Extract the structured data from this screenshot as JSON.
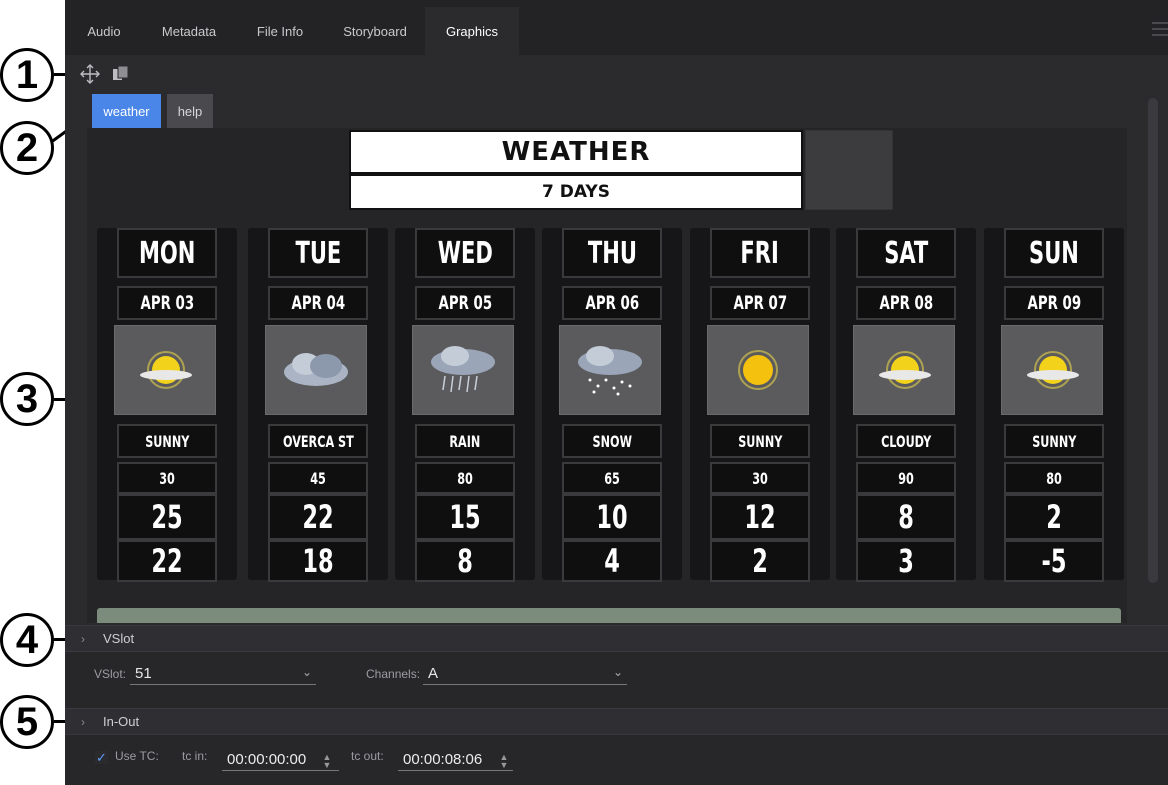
{
  "callouts": [
    "1",
    "2",
    "3",
    "4",
    "5"
  ],
  "tabs": [
    {
      "label": "Audio",
      "active": false
    },
    {
      "label": "Metadata",
      "active": false
    },
    {
      "label": "File Info",
      "active": false
    },
    {
      "label": "Storyboard",
      "active": false
    },
    {
      "label": "Graphics",
      "active": true
    }
  ],
  "toolbar": {
    "move_icon": "move-arrows-icon",
    "layers_icon": "copy-layers-icon"
  },
  "graphic_buttons": {
    "weather": "weather",
    "help": "help"
  },
  "weather": {
    "title": "WEATHER",
    "subtitle": "7 DAYS",
    "days": [
      {
        "day": "MON",
        "date": "APR 03",
        "icon": "sunny-icon",
        "condition": "SUNNY",
        "n1": "30",
        "n2": "25",
        "n3": "22"
      },
      {
        "day": "TUE",
        "date": "APR 04",
        "icon": "overcast-icon",
        "condition": "OVERCA ST",
        "n1": "45",
        "n2": "22",
        "n3": "18"
      },
      {
        "day": "WED",
        "date": "APR 05",
        "icon": "rain-icon",
        "condition": "RAIN",
        "n1": "80",
        "n2": "15",
        "n3": "8"
      },
      {
        "day": "THU",
        "date": "APR 06",
        "icon": "snow-icon",
        "condition": "SNOW",
        "n1": "65",
        "n2": "10",
        "n3": "4"
      },
      {
        "day": "FRI",
        "date": "APR 07",
        "icon": "sun-icon",
        "condition": "SUNNY",
        "n1": "30",
        "n2": "12",
        "n3": "2"
      },
      {
        "day": "SAT",
        "date": "APR 08",
        "icon": "sunny-icon",
        "condition": "CLOUDY",
        "n1": "90",
        "n2": "8",
        "n3": "3"
      },
      {
        "day": "SUN",
        "date": "APR 09",
        "icon": "sunny-icon",
        "condition": "SUNNY",
        "n1": "80",
        "n2": "2",
        "n3": "-5"
      }
    ]
  },
  "vslot": {
    "header": "VSlot",
    "vslot_label": "VSlot:",
    "vslot_value": "51",
    "channels_label": "Channels:",
    "channels_value": "A"
  },
  "inout": {
    "header": "In-Out",
    "use_tc_label": "Use TC:",
    "use_tc_checked": true,
    "tc_in_label": "tc in:",
    "tc_in_value": "00:00:00:00",
    "tc_out_label": "tc out:",
    "tc_out_value": "00:00:08:06"
  },
  "colors": {
    "accent": "#4a86e8",
    "panel": "#2b2b2e",
    "tabbar": "#232326"
  }
}
